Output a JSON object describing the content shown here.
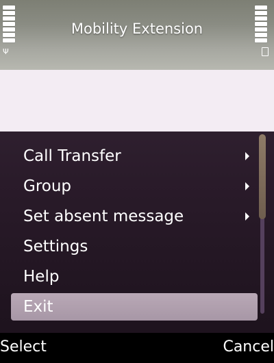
{
  "app": {
    "title": "Mobility Extension"
  },
  "status": {
    "signal_icon": "signal-icon",
    "battery_icon": "battery-icon"
  },
  "menu": {
    "items": [
      {
        "label": "Call Transfer",
        "submenu": true
      },
      {
        "label": "Group",
        "submenu": true
      },
      {
        "label": "Set absent message",
        "submenu": true
      },
      {
        "label": "Settings",
        "submenu": false
      },
      {
        "label": "Help",
        "submenu": false
      },
      {
        "label": "Exit",
        "submenu": false,
        "selected": true
      }
    ]
  },
  "softkeys": {
    "left": "Select",
    "right": "Cancel"
  },
  "colors": {
    "menu_bg": "#2a1b2a",
    "selected_bg": "#b3a1b1",
    "content_bg": "#f3ecf3",
    "watermark": "#cc0000"
  }
}
